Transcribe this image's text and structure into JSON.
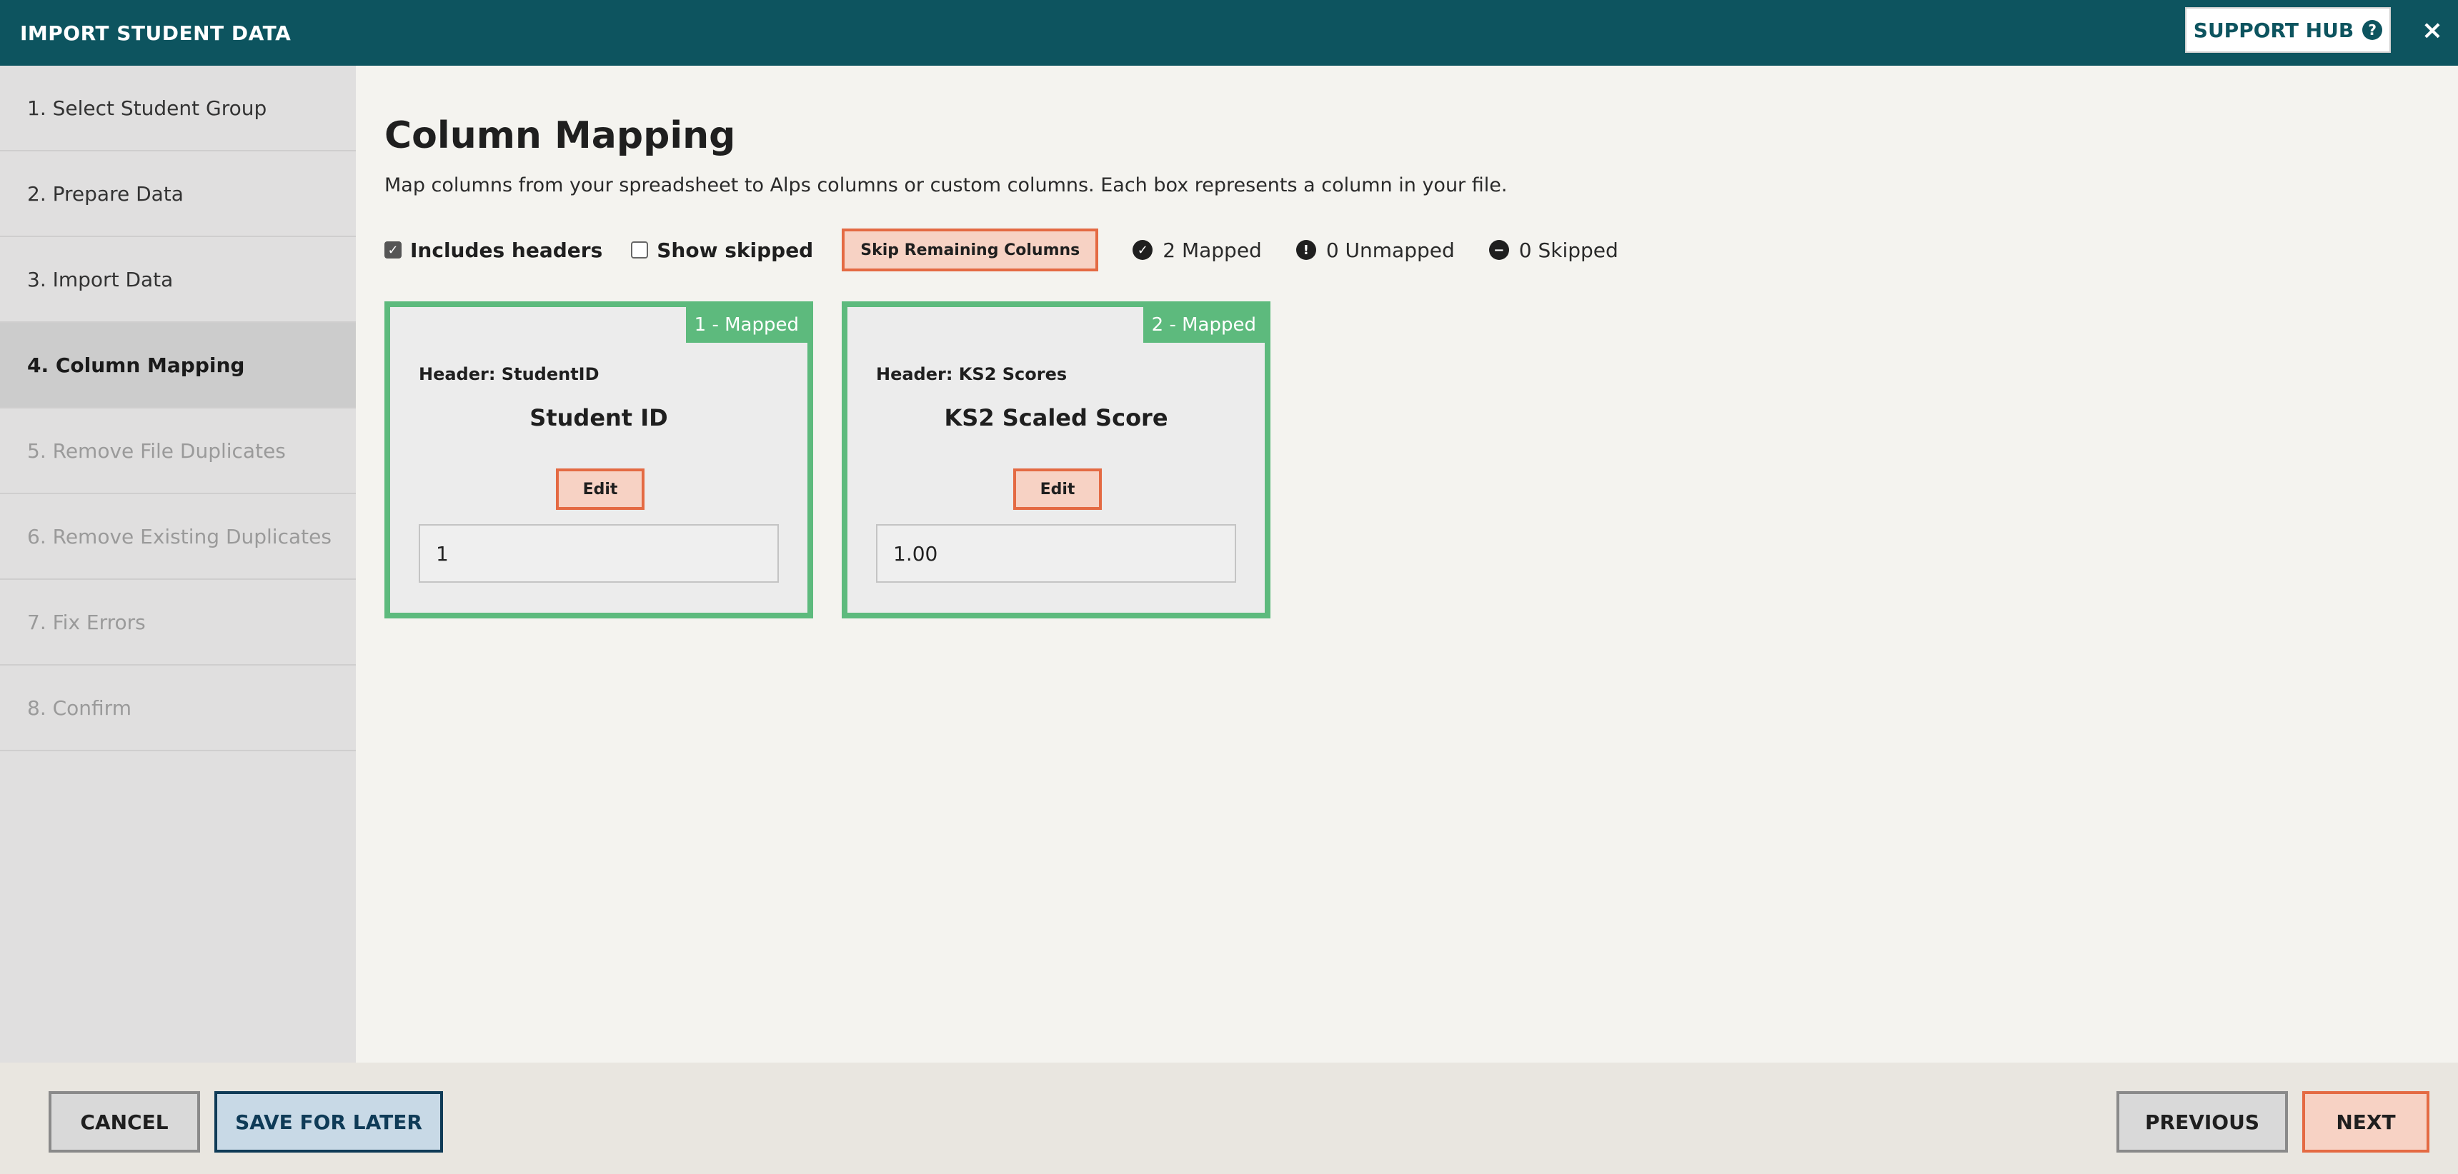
{
  "header": {
    "title": "IMPORT STUDENT DATA",
    "support_label": "SUPPORT HUB",
    "support_icon": "question-circle-icon",
    "close_glyph": "×"
  },
  "sidebar": {
    "steps": [
      {
        "label": "1. Select Student Group",
        "state": "done"
      },
      {
        "label": "2. Prepare Data",
        "state": "done"
      },
      {
        "label": "3. Import Data",
        "state": "done"
      },
      {
        "label": "4. Column Mapping",
        "state": "active"
      },
      {
        "label": "5. Remove File Duplicates",
        "state": "disabled"
      },
      {
        "label": "6. Remove Existing Duplicates",
        "state": "disabled"
      },
      {
        "label": "7. Fix Errors",
        "state": "disabled"
      },
      {
        "label": "8. Confirm",
        "state": "disabled"
      }
    ]
  },
  "main": {
    "title": "Column Mapping",
    "description": "Map columns from your spreadsheet to Alps columns or custom columns. Each box represents a column in your file.",
    "toolbar": {
      "includes_headers_label": "Includes headers",
      "includes_headers_checked": true,
      "show_skipped_label": "Show skipped",
      "show_skipped_checked": false,
      "skip_remaining_label": "Skip Remaining Columns",
      "mapped_label": "2 Mapped",
      "unmapped_label": "0 Unmapped",
      "skipped_label": "0 Skipped"
    },
    "cards": [
      {
        "badge": "1 - Mapped",
        "header": "Header: StudentID",
        "title": "Student ID",
        "edit_label": "Edit",
        "value": "1"
      },
      {
        "badge": "2 - Mapped",
        "header": "Header: KS2 Scores",
        "title": "KS2 Scaled Score",
        "edit_label": "Edit",
        "value": "1.00"
      }
    ]
  },
  "footer": {
    "cancel_label": "CANCEL",
    "save_label": "SAVE FOR LATER",
    "previous_label": "PREVIOUS",
    "next_label": "NEXT"
  },
  "colors": {
    "header_bg": "#0d545f",
    "mapped_green": "#5dba7d",
    "accent_orange": "#e46a43",
    "save_navy": "#0f3b57"
  }
}
